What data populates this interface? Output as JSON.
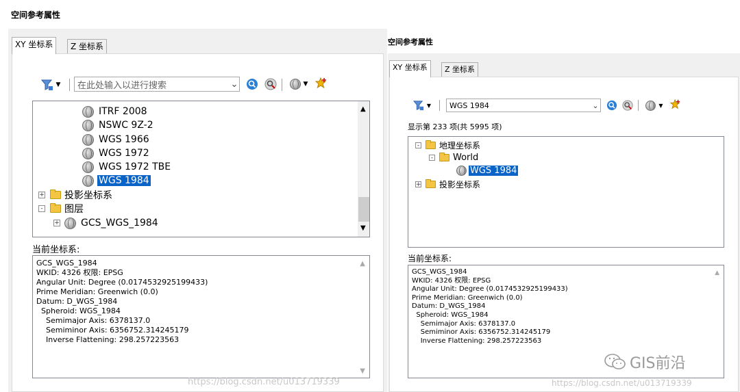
{
  "left": {
    "title": "空间参考属性",
    "tabs": [
      "XY 坐标系",
      "Z 坐标系"
    ],
    "search": {
      "value": "",
      "placeholder": "在此处输入以进行搜索"
    },
    "tree": [
      {
        "label": "ITRF 2008",
        "type": "globe"
      },
      {
        "label": "NSWC 9Z-2",
        "type": "globe"
      },
      {
        "label": "WGS 1966",
        "type": "globe"
      },
      {
        "label": "WGS 1972",
        "type": "globe"
      },
      {
        "label": "WGS 1972 TBE",
        "type": "globe"
      },
      {
        "label": "WGS 1984",
        "type": "globe",
        "selected": true
      },
      {
        "label": "投影坐标系",
        "type": "folder",
        "expander": "+"
      },
      {
        "label": "图层",
        "type": "folder-open",
        "expander": "-"
      },
      {
        "label": "GCS_WGS_1984",
        "type": "globe",
        "expander": "+"
      }
    ],
    "current_label": "当前坐标系:",
    "info_lines": [
      "GCS_WGS_1984",
      "WKID: 4326 权限: EPSG",
      "",
      "Angular Unit: Degree (0.0174532925199433)",
      "Prime Meridian: Greenwich (0.0)",
      "Datum: D_WGS_1984",
      "  Spheroid: WGS_1984",
      "    Semimajor Axis: 6378137.0",
      "    Semiminor Axis: 6356752.314245179",
      "    Inverse Flattening: 298.257223563"
    ],
    "watermark": "https://blog.csdn.net/u013719339"
  },
  "right": {
    "title": "空间参考属性",
    "tabs": [
      "XY 坐标系",
      "Z 坐标系"
    ],
    "search": {
      "value": "WGS 1984",
      "placeholder": ""
    },
    "result_text": "显示第 233 项(共 5995 项)",
    "tree": [
      {
        "label": "地理坐标系",
        "type": "folder-open",
        "expander": "-"
      },
      {
        "label": "World",
        "type": "folder-open",
        "expander": "-"
      },
      {
        "label": "WGS 1984",
        "type": "globe",
        "selected": true
      },
      {
        "label": "投影坐标系",
        "type": "folder",
        "expander": "+"
      }
    ],
    "current_label": "当前坐标系:",
    "info_lines": [
      "GCS_WGS_1984",
      "WKID: 4326 权限: EPSG",
      "",
      "Angular Unit: Degree (0.0174532925199433)",
      "Prime Meridian: Greenwich (0.0)",
      "Datum: D_WGS_1984",
      "  Spheroid: WGS_1984",
      "    Semimajor Axis: 6378137.0",
      "    Semiminor Axis: 6356752.314245179",
      "    Inverse Flattening: 298.257223563"
    ],
    "watermark": "https://blog.csdn.net/u013719339",
    "brand": "GIS前沿"
  },
  "icons": {
    "filter": "filter-icon",
    "search": "search-icon",
    "clear": "clear-search-icon",
    "globe": "globe-icon",
    "favorite": "favorite-star-icon"
  },
  "colors": {
    "selection": "#0a64c8",
    "folder": "#f4c542",
    "search_icon": "#2a7fd6",
    "star": "#f2b705"
  }
}
